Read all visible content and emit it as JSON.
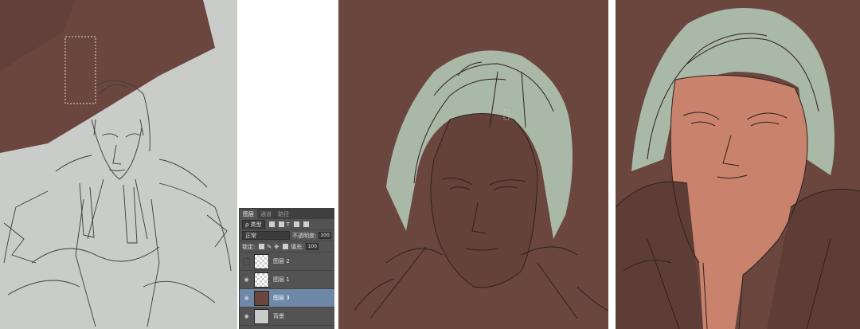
{
  "layers_panel": {
    "tabs": [
      "图层",
      "通道",
      "路径"
    ],
    "filter_label": "ρ 类型",
    "blend_mode": "正常",
    "opacity_label": "不透明度:",
    "opacity_value": "100",
    "lock_label": "锁定:",
    "fill_label": "填充:",
    "fill_value": "100",
    "layers": [
      {
        "name": "图层 2",
        "visible": false,
        "thumb": "transparent",
        "selected": false
      },
      {
        "name": "图层 1",
        "visible": true,
        "thumb": "transparent",
        "selected": false
      },
      {
        "name": "图层 3",
        "visible": true,
        "thumb": "brown",
        "selected": true
      },
      {
        "name": "背景",
        "visible": true,
        "thumb": "grey",
        "selected": false
      }
    ]
  },
  "colors": {
    "canvas_grey": "#c9ccc8",
    "brown": "#6a463f",
    "hair": "#aab8a8",
    "skin": "#c9826c",
    "selection_blue": "#6e89a8"
  }
}
